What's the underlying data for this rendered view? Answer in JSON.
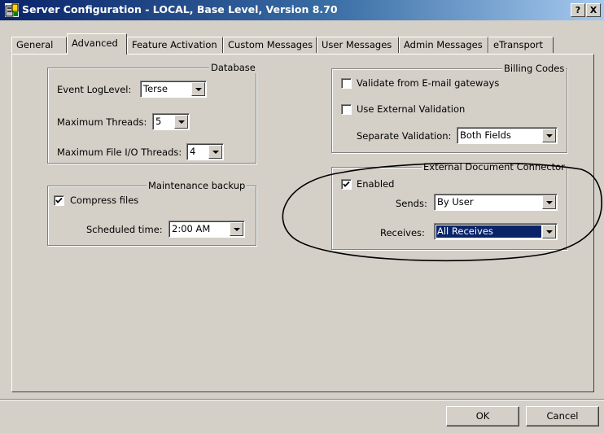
{
  "window": {
    "title": "Server Configuration - LOCAL, Base Level, Version 8.70",
    "help_label": "?",
    "close_label": "X"
  },
  "tabs": [
    {
      "label": "General"
    },
    {
      "label": "Advanced",
      "active": true
    },
    {
      "label": "Feature Activation"
    },
    {
      "label": "Custom Messages"
    },
    {
      "label": "User Messages"
    },
    {
      "label": "Admin Messages"
    },
    {
      "label": "eTransport"
    }
  ],
  "database": {
    "legend": "Database",
    "event_loglevel_label": "Event LogLevel:",
    "event_loglevel_value": "Terse",
    "max_threads_label": "Maximum Threads:",
    "max_threads_value": "5",
    "max_file_io_label": "Maximum File I/O Threads:",
    "max_file_io_value": "4"
  },
  "maintenance": {
    "legend": "Maintenance backup",
    "compress_label": "Compress files",
    "compress_checked": true,
    "scheduled_label": "Scheduled time:",
    "scheduled_value": "2:00 AM"
  },
  "billing": {
    "legend": "Billing Codes",
    "validate_email_label": "Validate from E-mail gateways",
    "validate_email_checked": false,
    "use_external_label": "Use External Validation",
    "use_external_checked": false,
    "separate_label": "Separate Validation:",
    "separate_value": "Both Fields"
  },
  "edc": {
    "legend": "External Document Connector",
    "enabled_label": "Enabled",
    "enabled_checked": true,
    "sends_label": "Sends:",
    "sends_value": "By User",
    "receives_label": "Receives:",
    "receives_value": "All Receives"
  },
  "buttons": {
    "ok_label": "OK",
    "cancel_label": "Cancel"
  }
}
